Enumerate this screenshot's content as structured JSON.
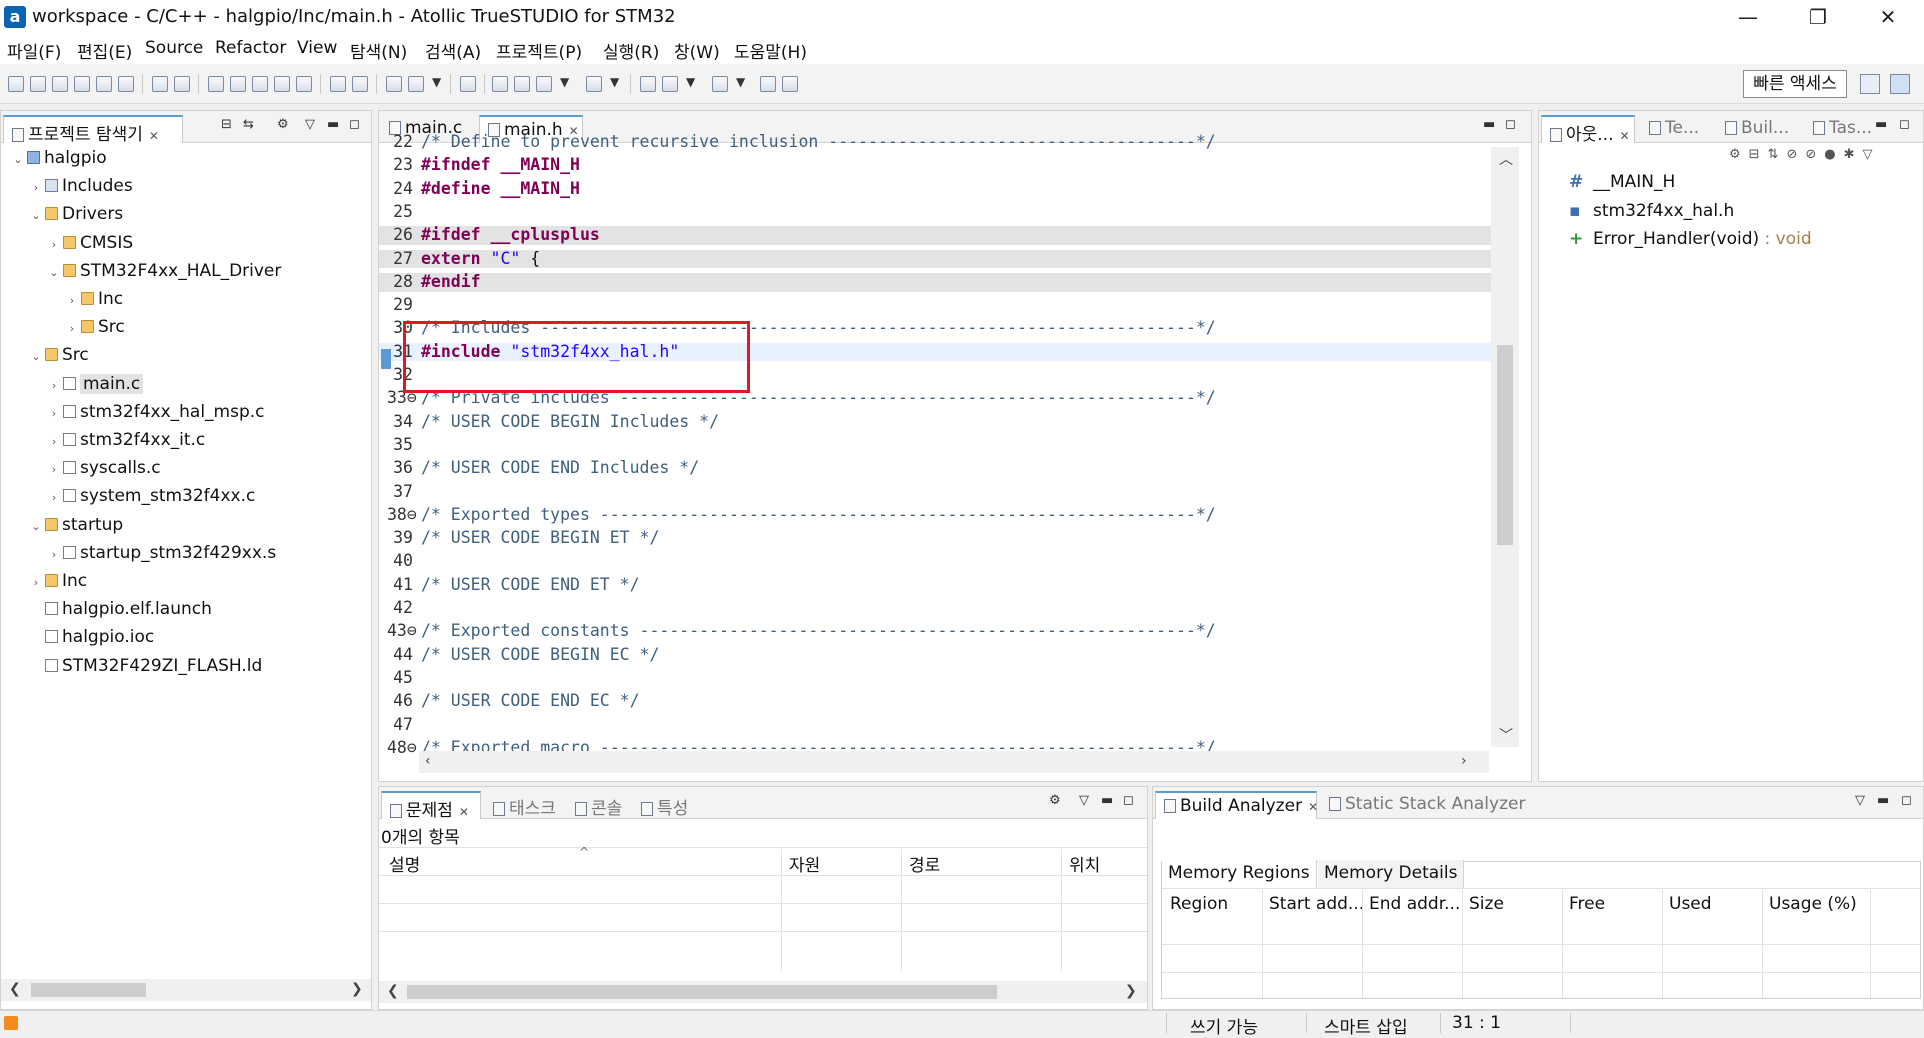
{
  "window": {
    "app_icon": "a",
    "title": "workspace - C/C++ - halgpio/Inc/main.h - Atollic TrueSTUDIO for STM32",
    "minimize_glyph": "—",
    "maximize_glyph": "❐",
    "close_glyph": "✕"
  },
  "menu": [
    "파일(F)",
    "편집(E)",
    "Source",
    "Refactor",
    "View",
    "탐색(N)",
    "검색(A)",
    "프로젝트(P)",
    "실행(R)",
    "창(W)",
    "도움말(H)"
  ],
  "toolbar": {
    "quick_access": "빠른 액세스"
  },
  "project_explorer": {
    "title": "프로젝트 탐색기",
    "tree": [
      {
        "label": "halgpio",
        "twisty": "⌄",
        "icon": "proj"
      },
      {
        "label": "Includes",
        "twisty": "›",
        "icon": "inc"
      },
      {
        "label": "Drivers",
        "twisty": "⌄",
        "icon": "folder"
      },
      {
        "label": "CMSIS",
        "twisty": "›",
        "icon": "folder"
      },
      {
        "label": "STM32F4xx_HAL_Driver",
        "twisty": "⌄",
        "icon": "folder"
      },
      {
        "label": "Inc",
        "twisty": "›",
        "icon": "folder"
      },
      {
        "label": "Src",
        "twisty": "›",
        "icon": "folder"
      },
      {
        "label": "Src",
        "twisty": "⌄",
        "icon": "folder"
      },
      {
        "label": "main.c",
        "twisty": "›",
        "icon": "file"
      },
      {
        "label": "stm32f4xx_hal_msp.c",
        "twisty": "›",
        "icon": "file"
      },
      {
        "label": "stm32f4xx_it.c",
        "twisty": "›",
        "icon": "file"
      },
      {
        "label": "syscalls.c",
        "twisty": "›",
        "icon": "file"
      },
      {
        "label": "system_stm32f4xx.c",
        "twisty": "›",
        "icon": "file"
      },
      {
        "label": "startup",
        "twisty": "⌄",
        "icon": "folder"
      },
      {
        "label": "startup_stm32f429xx.s",
        "twisty": "›",
        "icon": "file"
      },
      {
        "label": "Inc",
        "twisty": "›",
        "icon": "folder"
      },
      {
        "label": "halgpio.elf.launch",
        "twisty": "",
        "icon": "file"
      },
      {
        "label": "halgpio.ioc",
        "twisty": "",
        "icon": "file"
      },
      {
        "label": "STM32F429ZI_FLASH.ld",
        "twisty": "",
        "icon": "file"
      }
    ]
  },
  "editor": {
    "tabs": [
      "main.c",
      "main.h"
    ],
    "lines": [
      {
        "num": "22",
        "text": "/* Define to prevent recursive inclusion -------------------------------------*/"
      },
      {
        "num": "23",
        "text": "#ifndef __MAIN_H"
      },
      {
        "num": "24",
        "text": "#define __MAIN_H"
      },
      {
        "num": "25",
        "text": ""
      },
      {
        "num": "26",
        "text": "#ifdef __cplusplus"
      },
      {
        "num": "27",
        "text": "extern \"C\" {"
      },
      {
        "num": "28",
        "text": "#endif"
      },
      {
        "num": "29",
        "text": ""
      },
      {
        "num": "30",
        "text": "/* Includes ------------------------------------------------------------------*/"
      },
      {
        "num": "31",
        "text": "#include \"stm32f4xx_hal.h\""
      },
      {
        "num": "32",
        "text": ""
      },
      {
        "num": "33⊖",
        "text": "/* Private includes ----------------------------------------------------------*/"
      },
      {
        "num": "34",
        "text": "/* USER CODE BEGIN Includes */"
      },
      {
        "num": "35",
        "text": ""
      },
      {
        "num": "36",
        "text": "/* USER CODE END Includes */"
      },
      {
        "num": "37",
        "text": ""
      },
      {
        "num": "38⊖",
        "text": "/* Exported types ------------------------------------------------------------*/"
      },
      {
        "num": "39",
        "text": "/* USER CODE BEGIN ET */"
      },
      {
        "num": "40",
        "text": ""
      },
      {
        "num": "41",
        "text": "/* USER CODE END ET */"
      },
      {
        "num": "42",
        "text": ""
      },
      {
        "num": "43⊖",
        "text": "/* Exported constants --------------------------------------------------------*/"
      },
      {
        "num": "44",
        "text": "/* USER CODE BEGIN EC */"
      },
      {
        "num": "45",
        "text": ""
      },
      {
        "num": "46",
        "text": "/* USER CODE END EC */"
      },
      {
        "num": "47",
        "text": ""
      },
      {
        "num": "48⊖",
        "text": "/* Exported macro ------------------------------------------------------------*/"
      }
    ]
  },
  "outline": {
    "tabs": [
      "아웃...",
      "Te...",
      "Buil...",
      "Tas..."
    ],
    "items": [
      {
        "symbol": "#",
        "label": "__MAIN_H",
        "type": ""
      },
      {
        "symbol": "▪",
        "label": "stm32f4xx_hal.h",
        "type": ""
      },
      {
        "symbol": "+",
        "label": "Error_Handler(void)",
        "type": " : void"
      }
    ]
  },
  "problems": {
    "tabs": [
      "문제점",
      "태스크",
      "콘솔",
      "특성"
    ],
    "count": "0개의 항목",
    "columns": [
      "설명",
      "자원",
      "경로",
      "위치"
    ]
  },
  "build_analyzer": {
    "tabs": [
      "Build Analyzer",
      "Static Stack Analyzer"
    ],
    "subtabs": [
      "Memory Regions",
      "Memory Details"
    ],
    "columns": [
      "Region",
      "Start add...",
      "End addr...",
      "Size",
      "Free",
      "Used",
      "Usage (%)"
    ]
  },
  "statusbar": {
    "writable": "쓰기 가능",
    "insert_mode": "스마트 삽입",
    "position": "31 : 1"
  },
  "colors": {
    "highlight_box": "#e0181f",
    "keyword": "#7f0055",
    "string": "#2a00ff",
    "comment": "#3f5f7f",
    "active_tab_accent": "#5b9bd5"
  }
}
